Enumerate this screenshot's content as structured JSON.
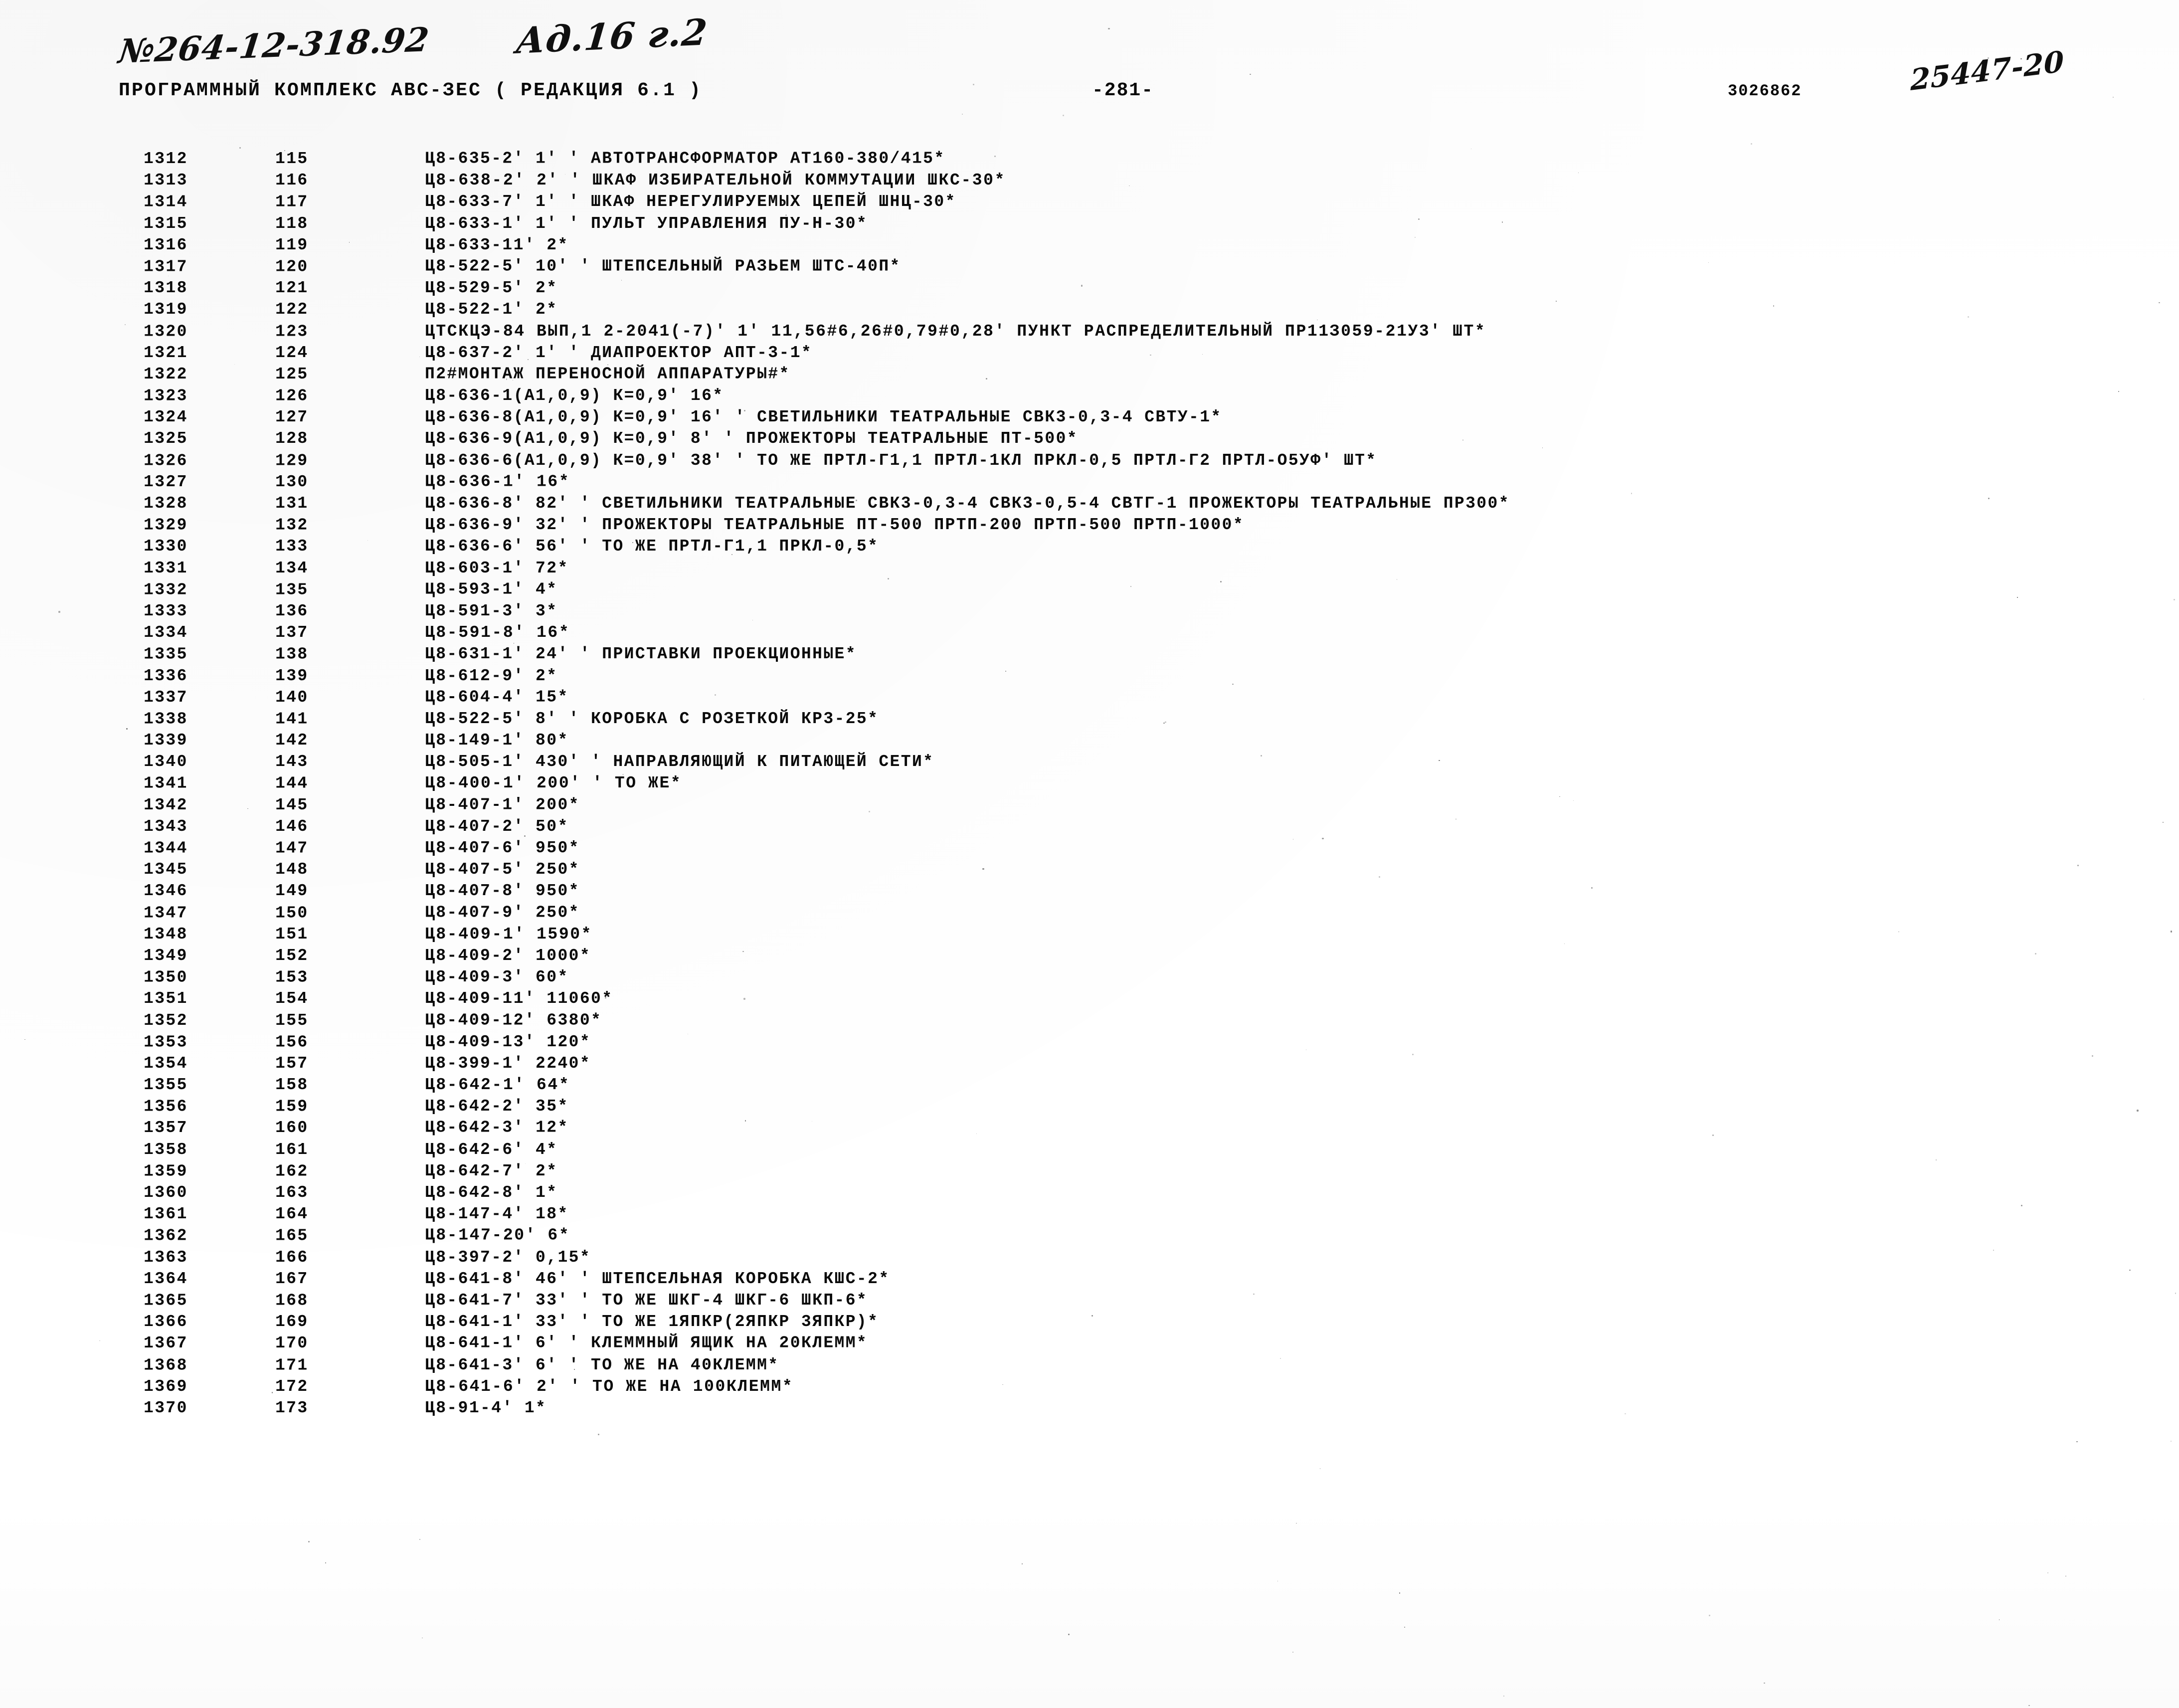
{
  "handwriting": {
    "doc_number": "№264-12-318.92",
    "annotation": "Ад.16 г.2",
    "stamp_number": "25447-20"
  },
  "header": {
    "program_line": "ПРОГРАММНЫЙ КОМПЛЕКС АВС-ЗЕС   ( РЕДАКЦИЯ  6.1 )",
    "page_number": "-281-",
    "job_number": "3026862"
  },
  "listing": {
    "columns": [
      "seq",
      "item",
      "body"
    ],
    "rows": [
      {
        "seq": "1312",
        "item": "115",
        "body": "Ц8-635-2' 1' ' АВТОТРАНСФОРМАТОР АТ160-380/415*"
      },
      {
        "seq": "1313",
        "item": "116",
        "body": "Ц8-638-2' 2' ' ШКАФ ИЗБИРАТЕЛЬНОЙ КОММУТАЦИИ ШКС-30*"
      },
      {
        "seq": "1314",
        "item": "117",
        "body": "Ц8-633-7' 1' ' ШКАФ НЕРЕГУЛИРУЕМЫХ ЦЕПЕЙ ШНЦ-30*"
      },
      {
        "seq": "1315",
        "item": "118",
        "body": "Ц8-633-1' 1' ' ПУЛЬТ УПРАВЛЕНИЯ ПУ-Н-30*"
      },
      {
        "seq": "1316",
        "item": "119",
        "body": "Ц8-633-11' 2*"
      },
      {
        "seq": "1317",
        "item": "120",
        "body": "Ц8-522-5' 10' ' ШТЕПСЕЛЬНЫЙ РАЗЬЕМ ШТС-40П*"
      },
      {
        "seq": "1318",
        "item": "121",
        "body": "Ц8-529-5' 2*"
      },
      {
        "seq": "1319",
        "item": "122",
        "body": "Ц8-522-1' 2*"
      },
      {
        "seq": "1320",
        "item": "123",
        "body": "ЦТСКЦЭ-84 ВЫП,1 2-2041(-7)' 1' 11,56#6,26#0,79#0,28' ПУНКТ РАСПРЕДЕЛИТЕЛЬНЫЙ ПР11З059-21У3' ШТ*"
      },
      {
        "seq": "1321",
        "item": "124",
        "body": "Ц8-637-2' 1' ' ДИАПРОЕКТОР АПТ-3-1*"
      },
      {
        "seq": "1322",
        "item": "125",
        "body": "П2#МОНТАЖ ПЕРЕНОСНОЙ АППАРАТУРЫ#*"
      },
      {
        "seq": "1323",
        "item": "126",
        "body": "Ц8-636-1(А1,0,9) К=0,9' 16*"
      },
      {
        "seq": "1324",
        "item": "127",
        "body": "Ц8-636-8(А1,0,9) К=0,9' 16' ' СВЕТИЛЬНИКИ ТЕАТРАЛЬНЫЕ СВК3-0,3-4 СВТУ-1*"
      },
      {
        "seq": "1325",
        "item": "128",
        "body": "Ц8-636-9(А1,0,9) К=0,9' 8' ' ПРОЖЕКТОРЫ ТЕАТРАЛЬНЫЕ ПТ-500*"
      },
      {
        "seq": "1326",
        "item": "129",
        "body": "Ц8-636-6(А1,0,9) К=0,9' 38' ' ТО ЖЕ ПРТЛ-Г1,1 ПРТЛ-1КЛ ПРКЛ-0,5 ПРТЛ-Г2 ПРТЛ-О5УФ' ШТ*"
      },
      {
        "seq": "1327",
        "item": "130",
        "body": "Ц8-636-1' 16*"
      },
      {
        "seq": "1328",
        "item": "131",
        "body": "Ц8-636-8' 82' ' СВЕТИЛЬНИКИ ТЕАТРАЛЬНЫЕ СВК3-0,3-4 СВК3-0,5-4 СВТГ-1 ПРОЖЕКТОРЫ ТЕАТРАЛЬНЫЕ ПР300*"
      },
      {
        "seq": "1329",
        "item": "132",
        "body": "Ц8-636-9' 32' ' ПРОЖЕКТОРЫ ТЕАТРАЛЬНЫЕ ПТ-500 ПРТП-200 ПРТП-500 ПРТП-1000*"
      },
      {
        "seq": "1330",
        "item": "133",
        "body": "Ц8-636-6' 56' ' ТО ЖЕ ПРТЛ-Г1,1 ПРКЛ-0,5*"
      },
      {
        "seq": "1331",
        "item": "134",
        "body": "Ц8-603-1' 72*"
      },
      {
        "seq": "1332",
        "item": "135",
        "body": "Ц8-593-1' 4*"
      },
      {
        "seq": "1333",
        "item": "136",
        "body": "Ц8-591-3' 3*"
      },
      {
        "seq": "1334",
        "item": "137",
        "body": "Ц8-591-8' 16*"
      },
      {
        "seq": "1335",
        "item": "138",
        "body": "Ц8-631-1' 24' ' ПРИСТАВКИ ПРОЕКЦИОННЫЕ*"
      },
      {
        "seq": "1336",
        "item": "139",
        "body": "Ц8-612-9' 2*"
      },
      {
        "seq": "1337",
        "item": "140",
        "body": "Ц8-604-4' 15*"
      },
      {
        "seq": "1338",
        "item": "141",
        "body": "Ц8-522-5' 8' ' КОРОБКА С РОЗЕТКОЙ КР3-25*"
      },
      {
        "seq": "1339",
        "item": "142",
        "body": "Ц8-149-1' 80*"
      },
      {
        "seq": "1340",
        "item": "143",
        "body": "Ц8-505-1' 430' ' НАПРАВЛЯЮЩИЙ К ПИТАЮЩЕЙ СЕТИ*"
      },
      {
        "seq": "1341",
        "item": "144",
        "body": "Ц8-400-1' 200' ' ТО ЖЕ*"
      },
      {
        "seq": "1342",
        "item": "145",
        "body": "Ц8-407-1' 200*"
      },
      {
        "seq": "1343",
        "item": "146",
        "body": "Ц8-407-2' 50*"
      },
      {
        "seq": "1344",
        "item": "147",
        "body": "Ц8-407-6' 950*"
      },
      {
        "seq": "1345",
        "item": "148",
        "body": "Ц8-407-5' 250*"
      },
      {
        "seq": "1346",
        "item": "149",
        "body": "Ц8-407-8' 950*"
      },
      {
        "seq": "1347",
        "item": "150",
        "body": "Ц8-407-9' 250*"
      },
      {
        "seq": "1348",
        "item": "151",
        "body": "Ц8-409-1' 1590*"
      },
      {
        "seq": "1349",
        "item": "152",
        "body": "Ц8-409-2' 1000*"
      },
      {
        "seq": "1350",
        "item": "153",
        "body": "Ц8-409-3' 60*"
      },
      {
        "seq": "1351",
        "item": "154",
        "body": "Ц8-409-11' 11060*"
      },
      {
        "seq": "1352",
        "item": "155",
        "body": "Ц8-409-12' 6380*"
      },
      {
        "seq": "1353",
        "item": "156",
        "body": "Ц8-409-13' 120*"
      },
      {
        "seq": "1354",
        "item": "157",
        "body": "Ц8-399-1' 2240*"
      },
      {
        "seq": "1355",
        "item": "158",
        "body": "Ц8-642-1' 64*"
      },
      {
        "seq": "1356",
        "item": "159",
        "body": "Ц8-642-2' 35*"
      },
      {
        "seq": "1357",
        "item": "160",
        "body": "Ц8-642-3' 12*"
      },
      {
        "seq": "1358",
        "item": "161",
        "body": "Ц8-642-6' 4*"
      },
      {
        "seq": "1359",
        "item": "162",
        "body": "Ц8-642-7' 2*"
      },
      {
        "seq": "1360",
        "item": "163",
        "body": "Ц8-642-8' 1*"
      },
      {
        "seq": "1361",
        "item": "164",
        "body": "Ц8-147-4' 18*"
      },
      {
        "seq": "1362",
        "item": "165",
        "body": "Ц8-147-20' 6*"
      },
      {
        "seq": "1363",
        "item": "166",
        "body": "Ц8-397-2' 0,15*"
      },
      {
        "seq": "1364",
        "item": "167",
        "body": "Ц8-641-8' 46' ' ШТЕПСЕЛЬНАЯ КОРОБКА КШС-2*"
      },
      {
        "seq": "1365",
        "item": "168",
        "body": "Ц8-641-7' 33' ' ТО ЖЕ ШКГ-4 ШКГ-6 ШКП-6*"
      },
      {
        "seq": "1366",
        "item": "169",
        "body": "Ц8-641-1' 33' ' ТО ЖЕ 1ЯПКР(2ЯПКР 3ЯПКР)*"
      },
      {
        "seq": "1367",
        "item": "170",
        "body": "Ц8-641-1' 6' ' КЛЕММНЫЙ ЯЩИК НА 20КЛЕММ*"
      },
      {
        "seq": "1368",
        "item": "171",
        "body": "Ц8-641-3' 6' ' ТО ЖЕ НА 40КЛЕММ*"
      },
      {
        "seq": "1369",
        "item": "172",
        "body": "Ц8-641-6' 2' ' ТО ЖЕ НА 100КЛЕММ*"
      },
      {
        "seq": "1370",
        "item": "173",
        "body": "Ц8-91-4' 1*"
      }
    ]
  }
}
